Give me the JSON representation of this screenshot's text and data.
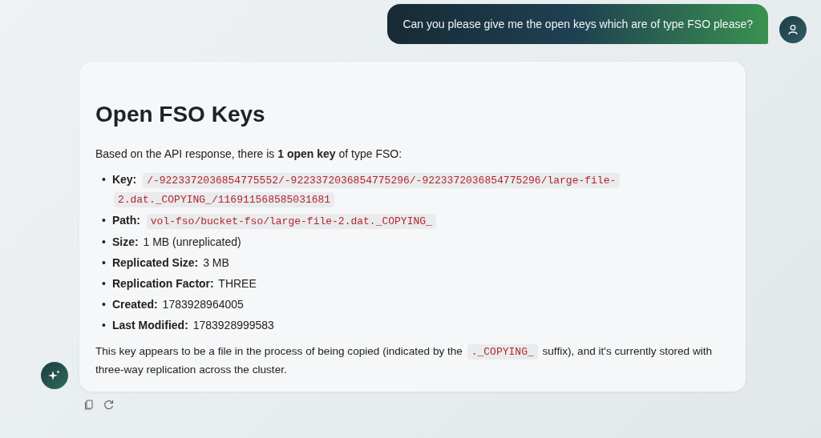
{
  "user_message": {
    "text": "Can you please give me the open keys which are of type FSO please?"
  },
  "response": {
    "heading": "Open FSO Keys",
    "intro": "Based on the API response, there is **1 open key** of type FSO:",
    "items": [
      {
        "marker": "•",
        "label": "Key:",
        "kind": "code",
        "value_lines": [
          "/-9223372036854775552/-9223372036854775296/-9223372036854775296/large-file-",
          "2.dat._COPYING_/116911568585031681"
        ]
      },
      {
        "marker": "•",
        "label": "Path:",
        "kind": "code",
        "value_lines": [
          "vol-fso/bucket-fso/large-file-2.dat._COPYING_"
        ]
      },
      {
        "marker": "•",
        "label": "Size:",
        "kind": "text",
        "value": "1 MB (unreplicated)"
      },
      {
        "marker": "•",
        "label": "Replicated Size:",
        "kind": "text",
        "value": "3 MB"
      },
      {
        "marker": "•",
        "label": "Replication Factor:",
        "kind": "text",
        "value": "THREE"
      },
      {
        "marker": "•",
        "label": "Created:",
        "kind": "text",
        "value": "1783928964005"
      },
      {
        "marker": "•",
        "label": "Last Modified:",
        "kind": "text",
        "value": "1783928999583"
      }
    ],
    "closing": [
      {
        "kind": "text",
        "text": "This key appears to be a file in the process of being copied (indicated by the "
      },
      {
        "kind": "code",
        "text": "._COPYING_"
      },
      {
        "kind": "text",
        "text": " suffix), and it's currently stored with three-way replication across the cluster."
      }
    ]
  }
}
